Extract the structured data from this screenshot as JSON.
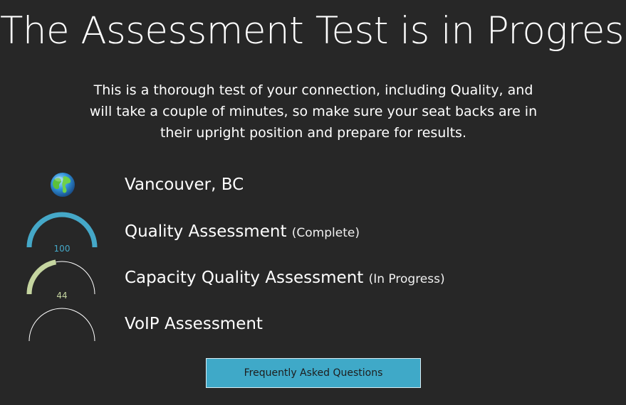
{
  "title": "The Assessment Test is in Progress",
  "intro": "This is a thorough test of your connection, including Quality, and will take a couple of minutes, so make sure your seat backs are in their upright position and prepare for results.",
  "location": {
    "icon": "globe-icon",
    "label": "Vancouver, BC"
  },
  "assessments": [
    {
      "label": "Quality Assessment",
      "status": "(Complete)",
      "value": "100",
      "progress": 1.0,
      "color": "#45a8c8"
    },
    {
      "label": "Capacity Quality Assessment",
      "status": "(In Progress)",
      "value": "44",
      "progress": 0.44,
      "color": "#c5d5a0"
    },
    {
      "label": "VoIP Assessment",
      "status": "",
      "value": "",
      "progress": 0,
      "color": "#ffffff"
    }
  ],
  "faq_button": {
    "label": "Frequently Asked Questions"
  },
  "colors": {
    "background": "#272727",
    "track": "#ffffff",
    "button": "#3fa9c8"
  }
}
